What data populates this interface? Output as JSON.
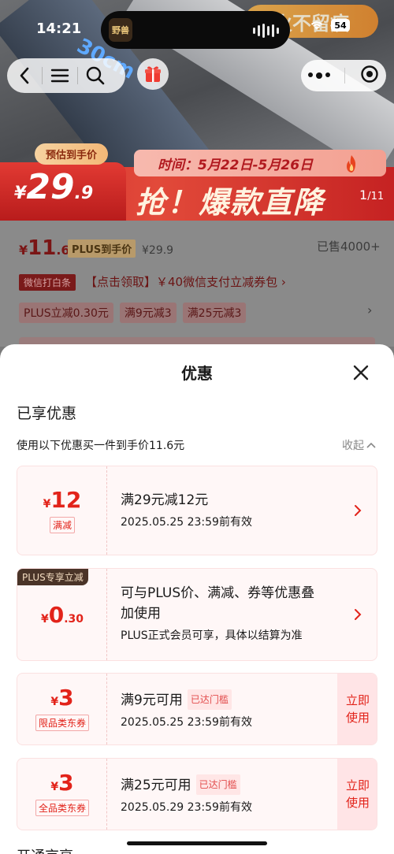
{
  "status_bar": {
    "time": "14:21",
    "battery": "54"
  },
  "dynamic_island": {
    "app_icon_text": "野兽"
  },
  "hero": {
    "ruler_text": "30cm",
    "top_banner_text": "火不留痕",
    "promo_tag": "预估到手价",
    "promo_price": {
      "symbol": "¥",
      "integer": "29",
      "decimal": ".9"
    },
    "promo_time": "时间：5月22日-5月26日",
    "promo_slogan": "抢！爆款直降",
    "page_current": "1",
    "page_total": "/11"
  },
  "product": {
    "price": {
      "symbol": "¥",
      "integer": "11",
      "decimal": ".6"
    },
    "plus_label": "PLUS到手价",
    "original_price": "¥29.9",
    "sold": "已售4000+",
    "wechat_tag": "微信打白条",
    "wechat_text": "【点击领取】￥40微信支付立减券包 ›",
    "coupon_chips": [
      "PLUS立减0.30元",
      "满9元减3",
      "满25元减3"
    ]
  },
  "sheet": {
    "title": "优惠",
    "section_title": "已享优惠",
    "description": "使用以下优惠买一件到手价11.6元",
    "collapse_label": "收起",
    "cards": [
      {
        "amount_symbol": "¥",
        "amount_integer": "12",
        "amount_decimal": "",
        "badge": "满减",
        "title": "满29元减12元",
        "subtitle": "2025.05.25 23:59前有效"
      },
      {
        "corner_label": "PLUS专享立减",
        "amount_symbol": "¥",
        "amount_integer": "0",
        "amount_decimal": ".30",
        "title_line1": "可与PLUS价、满减、券等优惠叠",
        "title_line2": "加使用",
        "subtitle": "PLUS正式会员可享，具体以结算为准"
      },
      {
        "amount_symbol": "¥",
        "amount_integer": "3",
        "amount_decimal": "",
        "badge": "限品类东券",
        "title": "满9元可用",
        "threshold": "已达门槛",
        "subtitle": "2025.05.25 23:59前有效",
        "action_line1": "立即",
        "action_line2": "使用"
      },
      {
        "amount_symbol": "¥",
        "amount_integer": "3",
        "amount_decimal": "",
        "badge": "全品类东券",
        "title": "满25元可用",
        "threshold": "已达门槛",
        "subtitle": "2025.05.29 23:59前有效",
        "action_line1": "立即",
        "action_line2": "使用"
      }
    ],
    "footer_title": "开通京享"
  },
  "colors": {
    "accent": "#e2231a",
    "card_bg": "#fff7f7",
    "use_btn_bg": "#ffe4e6",
    "plus_corner": "#4a3428"
  }
}
